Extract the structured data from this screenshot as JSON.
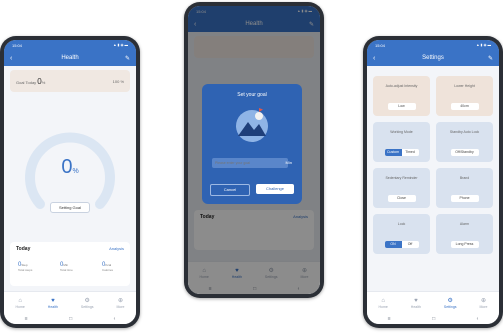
{
  "phone1": {
    "status_time": "15:04",
    "status_icons": "▲ ▮ ◉ ▬",
    "header_title": "Health",
    "goal_label": "Goal Today",
    "goal_value": "0",
    "goal_unit": "%",
    "goal_right": "100 %",
    "progress_value": "0",
    "progress_unit": "%",
    "progress_fraction": 0,
    "set_goal_button": "Setting Goal",
    "today_title": "Today",
    "analysis_link": "Analysis",
    "stats": [
      {
        "value": "0",
        "unit": "Step",
        "label": "Total steps"
      },
      {
        "value": "0",
        "unit": "Min",
        "label": "Total time"
      },
      {
        "value": "0",
        "unit": "Kcal",
        "label": "Calories"
      }
    ],
    "nav": [
      "Home",
      "Health",
      "Settings",
      "More"
    ],
    "nav_active": 1
  },
  "phone2": {
    "status_time": "15:04",
    "header_title": "Health",
    "dialog_title": "Set your goal",
    "input_placeholder": "Please enter your goal",
    "input_unit": "Min",
    "cancel_label": "Cancel",
    "confirm_label": "Challenge",
    "today_title": "Today",
    "analysis_link": "Analysis",
    "nav": [
      "Home",
      "Health",
      "Settings",
      "More"
    ],
    "nav_active": 1
  },
  "phone3": {
    "status_time": "15:04",
    "header_title": "Settings",
    "tiles": [
      {
        "title": "Auto-adjust Intensity",
        "button": "Low",
        "warm": true
      },
      {
        "title": "Lower Height",
        "button": "40cm",
        "warm": true
      },
      {
        "title": "Working Mode",
        "seg": [
          "Custom",
          "Timed"
        ],
        "seg_on": 0
      },
      {
        "title": "Standby Auto Lock",
        "button": "Off/Standby"
      },
      {
        "title": "Sedentary Reminder",
        "button": "Close"
      },
      {
        "title": "Brand",
        "button": "Phone"
      },
      {
        "title": "Lock",
        "seg": [
          "ON",
          "Off"
        ],
        "seg_on": 0
      },
      {
        "title": "Alarm",
        "button": "Long Press"
      }
    ],
    "nav": [
      "Home",
      "Health",
      "Settings",
      "More"
    ],
    "nav_active": 2
  },
  "sysbar": [
    "≡",
    "□",
    "‹"
  ],
  "colors": {
    "accent": "#3a73c6",
    "dialog": "#2f63b3",
    "warm_tile": "#efe3da",
    "cool_tile": "#d9e2ef"
  }
}
